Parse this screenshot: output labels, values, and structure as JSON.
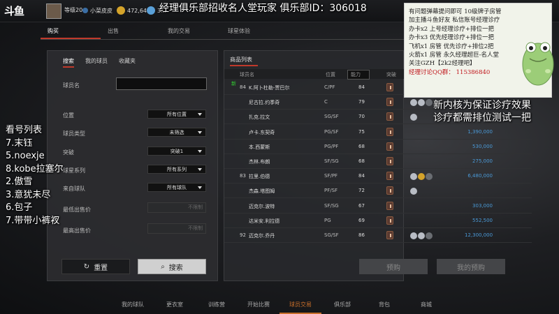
{
  "app": {
    "logo": "斗鱼"
  },
  "user": {
    "level": "等级20",
    "name": "小菜皮皮",
    "coins": "472,642",
    "extra": "3..."
  },
  "overlay_title": "经理俱乐部招收名人堂玩家 俱乐部ID：306018",
  "tabs": [
    "购买",
    "出售",
    "我的交易",
    "球星体验"
  ],
  "left": {
    "subtabs": [
      "搜索",
      "我的球员",
      "收藏夹"
    ],
    "name_label": "球员名",
    "filters": [
      {
        "label": "位置",
        "value": "所有位置"
      },
      {
        "label": "球员类型",
        "value": "未筛选"
      },
      {
        "label": "突破",
        "value": "突破1"
      },
      {
        "label": "球星系列",
        "value": "所有系列"
      },
      {
        "label": "来自球队",
        "value": "所有球队"
      }
    ],
    "price_filters": [
      {
        "label": "最低出售价",
        "placeholder": "不限制"
      },
      {
        "label": "最高出售价",
        "placeholder": "不限制"
      }
    ],
    "reset": "重置",
    "search": "搜索"
  },
  "right": {
    "tab": "商品列表",
    "headers": {
      "name": "球员名",
      "pos": "位置",
      "rating": "能力",
      "breakthrough": "突破"
    },
    "rows": [
      {
        "ovr": "84",
        "name": "K.阿卜杜勒-贾巴尔",
        "pos": "C/PF",
        "rating": "84",
        "price": "",
        "medals": [],
        "tag": "新"
      },
      {
        "ovr": "",
        "name": "尼古拉.约季奇",
        "pos": "C",
        "rating": "79",
        "price": "",
        "medals": [
          "silver",
          "silver",
          "gray"
        ]
      },
      {
        "ovr": "",
        "name": "扎克.拉文",
        "pos": "SG/SF",
        "rating": "70",
        "price": "",
        "medals": [
          "silver"
        ]
      },
      {
        "ovr": "",
        "name": "卢卡.东契奇",
        "pos": "PG/SF",
        "rating": "75",
        "price": "1,390,000",
        "medals": []
      },
      {
        "ovr": "",
        "name": "本.西蒙斯",
        "pos": "PG/PF",
        "rating": "68",
        "price": "530,000",
        "medals": []
      },
      {
        "ovr": "",
        "name": "杰林.布朗",
        "pos": "SF/SG",
        "rating": "68",
        "price": "275,000",
        "medals": []
      },
      {
        "ovr": "83",
        "name": "拉里.伯德",
        "pos": "SF/PF",
        "rating": "84",
        "price": "6,480,000",
        "medals": [
          "silver",
          "gold",
          "gray"
        ]
      },
      {
        "ovr": "",
        "name": "杰森.塔图姆",
        "pos": "PF/SF",
        "rating": "72",
        "price": "",
        "medals": [
          "silver"
        ]
      },
      {
        "ovr": "",
        "name": "迈克尔.波特",
        "pos": "SF/SG",
        "rating": "67",
        "price": "303,000",
        "medals": []
      },
      {
        "ovr": "",
        "name": "达米安.利拉德",
        "pos": "PG",
        "rating": "69",
        "price": "552,500",
        "medals": []
      },
      {
        "ovr": "92",
        "name": "迈克尔.乔丹",
        "pos": "SG/SF",
        "rating": "86",
        "price": "12,300,000",
        "medals": [
          "silver",
          "silver",
          "gray"
        ]
      }
    ],
    "buy": "预购",
    "sell": "我的预购"
  },
  "bottom_nav": [
    "我的球队",
    "更衣室",
    "训练营",
    "开始比赛",
    "球员交易",
    "俱乐部",
    "背包",
    "商城"
  ],
  "notes": {
    "lines": [
      "有问题弹幕提问即可 10级牌子房管",
      "加主播斗鱼好友 私信账号经理诊疗",
      "办卡x2 上号经理诊疗+排位一把",
      "办卡x3 优先经理诊疗+排位一把",
      "飞机x1 房管 优先诊疗+排位2把",
      "火箭x1 房管 永久经理超巨-名人堂",
      "关注GZH【2k2经理吧】",
      "经理讨论QQ群： 115386840"
    ]
  },
  "notice": [
    "新内核为保证诊疗效果",
    "诊疗都需排位测试一把"
  ],
  "queue": [
    "看号列表",
    "7.末钰",
    "5.noexje",
    "8.kobe拉塞尔",
    "2.傲雪",
    "3.意犹未尽",
    "6.包子",
    "7.带带小裤衩"
  ]
}
